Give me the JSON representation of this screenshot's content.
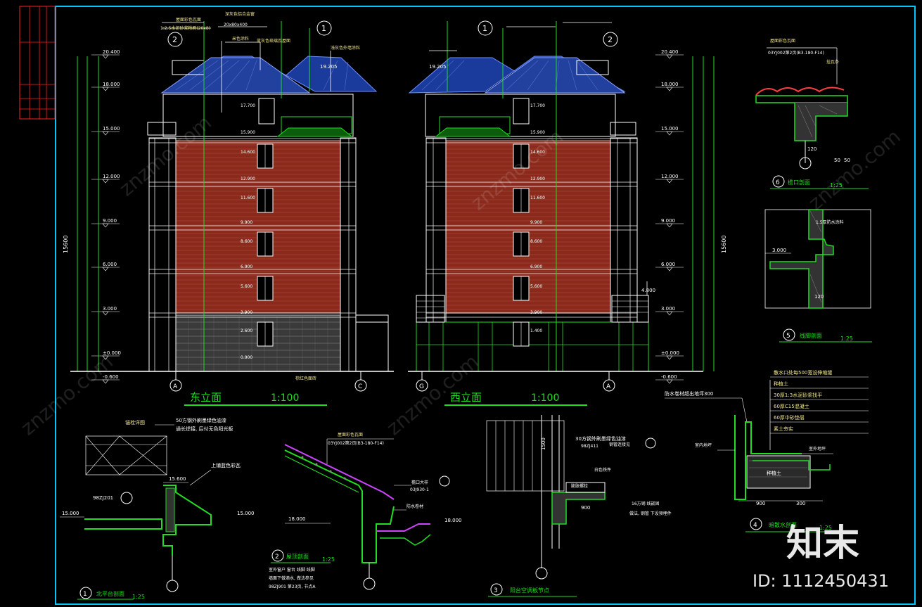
{
  "colors": {
    "background": "#000000",
    "frame": "#00c8ff",
    "border": "#ff2020",
    "brick": "#8a2a1c",
    "roof": "#1a3a9c",
    "green": "#22dd22",
    "white": "#ffffff",
    "yellow": "#f0e68c",
    "magenta": "#cc44ff"
  },
  "east_elevation": {
    "title": "东立面",
    "scale": "1:100",
    "axis_left": "A",
    "axis_right": "C",
    "levels_left": [
      "20.400",
      "18.000",
      "15.000",
      "12.000",
      "9.000",
      "6.000",
      "3.000",
      "±0.000",
      "-0.600"
    ],
    "floor_labels": [
      "17.700",
      "15.900",
      "14.600",
      "12.900",
      "11.600",
      "9.900",
      "8.600",
      "6.900",
      "5.600",
      "3.900",
      "2.600",
      "0.900"
    ],
    "total": "15600",
    "notes": [
      "屋面彩色瓦面",
      "1:2.5水泥砂浆粉刷(20x8)",
      "20x80x400",
      "深灰色铝合金窗",
      "米色涂料",
      "蓝灰色琉璃瓦屋面",
      "浅灰色外墙涂料",
      "棕红色面砖"
    ],
    "callout_right": "19.205"
  },
  "west_elevation": {
    "title": "西立面",
    "scale": "1:100",
    "axis_left": "G",
    "axis_right": "A",
    "levels_right": [
      "20.400",
      "18.000",
      "15.000",
      "12.000",
      "9.000",
      "6.000",
      "3.000",
      "±0.000",
      "-0.600"
    ],
    "floor_labels": [
      "17.700",
      "15.900",
      "14.600",
      "12.900",
      "11.600",
      "9.900",
      "8.600",
      "6.900",
      "5.600",
      "3.900",
      "1.400"
    ],
    "total": "15600",
    "callout_left": "19.205",
    "callout_right": "4.800"
  },
  "details": [
    {
      "num": "1",
      "title": "北平台剖面",
      "scale": "1:25",
      "notes": [
        "50方钢外刷墨绿色油漆",
        "通长焊接, 后付无色阳光板",
        "上铺蓝色彩瓦",
        "98ZJ201",
        "15.600",
        "15.000"
      ]
    },
    {
      "num": "2",
      "title": "屋顶剖面",
      "scale": "1:25",
      "notes": [
        "屋面彩色瓦面",
        "03YJ002第2页(B3-180-F14)",
        "檐口大样",
        "03J930-1",
        "防水卷材",
        "18.000",
        "98ZJ901 第23页, 节点A"
      ]
    },
    {
      "num": "3",
      "title": "阳台空调板节点",
      "scale": "",
      "notes": [
        "30方钢外刷墨绿色油漆",
        "98ZJ411",
        "钢管连接见",
        "白色铁件",
        "膨胀螺栓",
        "16方钢 线嵌固",
        "做法, 钢管 下设预埋件",
        "900",
        "1500"
      ]
    },
    {
      "num": "4",
      "title": "暗散水剖面",
      "scale": "1:25",
      "notes": [
        "散水口处每500宽设伸缩缝",
        "种植土",
        "30厚1:3水泥砂浆找平",
        "60厚C15混凝土",
        "60厚中砂垫层",
        "素土夯实",
        "防水卷材超出地坪300",
        "室内地坪",
        "室外地坪",
        "900",
        "300"
      ]
    },
    {
      "num": "5",
      "title": "线脚剖面",
      "scale": "1:25",
      "notes": [
        "1.5厚防水涂料",
        "3.000",
        "120"
      ]
    },
    {
      "num": "6",
      "title": "檐口剖面",
      "scale": "1:25",
      "notes": [
        "屋面彩色瓦面",
        "03YJ002第2页(B3-180-F14)",
        "挂瓦条",
        "50",
        "50",
        "120"
      ]
    }
  ],
  "watermark": {
    "text": "znzmo.com",
    "brand": "知末",
    "id": "ID: 1112450431"
  }
}
